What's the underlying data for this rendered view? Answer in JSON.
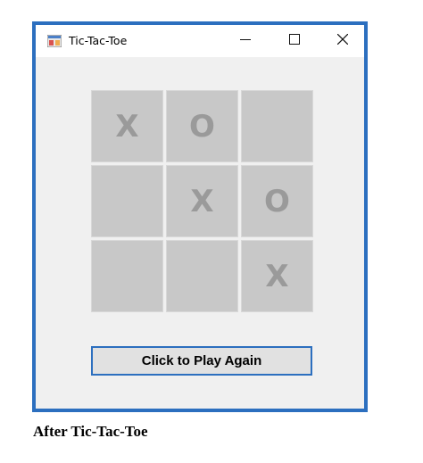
{
  "window": {
    "title": "Tic-Tac-Toe",
    "app_icon": "winforms-app-icon",
    "minimize_icon": "minimize-icon",
    "maximize_icon": "maximize-icon",
    "close_icon": "close-icon"
  },
  "board": {
    "cells": [
      "X",
      "O",
      "",
      "",
      "X",
      "O",
      "",
      "",
      "X"
    ]
  },
  "play_again_button": {
    "label": "Click to Play Again"
  },
  "figure_caption": "After Tic-Tac-Toe",
  "colors": {
    "window_border": "#2c6fbf",
    "cell_background": "#c8c8c8",
    "mark_color": "#9a9a9a",
    "client_area": "#f0f0f0"
  }
}
